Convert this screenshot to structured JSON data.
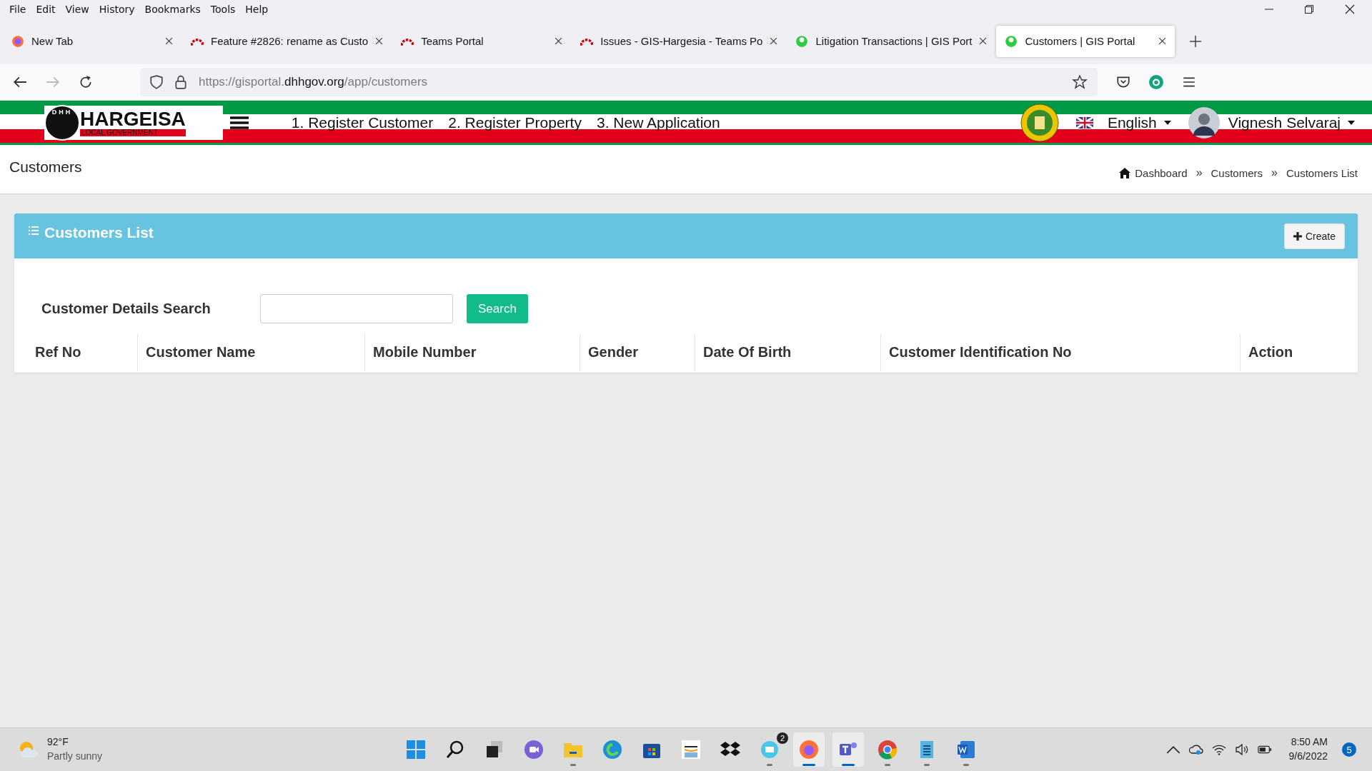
{
  "menu_bar": [
    "File",
    "Edit",
    "View",
    "History",
    "Bookmarks",
    "Tools",
    "Help"
  ],
  "tabs": [
    {
      "title": "New Tab",
      "kind": "firefox",
      "selected": false
    },
    {
      "title": "Feature #2826: rename as Custo",
      "kind": "redmine",
      "selected": false
    },
    {
      "title": "Teams Portal",
      "kind": "redmine",
      "selected": false
    },
    {
      "title": "Issues - GIS-Hargesia - Teams Po",
      "kind": "redmine",
      "selected": false
    },
    {
      "title": "Litigation Transactions | GIS Port",
      "kind": "gis",
      "selected": false
    },
    {
      "title": "Customers | GIS Portal",
      "kind": "gis",
      "selected": true
    }
  ],
  "address_bar": {
    "prefix": "https://gisportal.",
    "domain": "dhhgov.org",
    "path": "/app/customers"
  },
  "app_header": {
    "logo_initials": "DHH",
    "logo_title": "HARGEISA",
    "logo_subtitle": "LOCAL GOVERNMENT",
    "nav": [
      "1. Register Customer",
      "2. Register Property",
      "3. New Application"
    ],
    "language": "English",
    "user": "Vignesh Selvaraj"
  },
  "page": {
    "title": "Customers",
    "breadcrumb": [
      "Dashboard",
      "Customers",
      "Customers List"
    ],
    "separator": "»"
  },
  "panel": {
    "title": "Customers List",
    "create_button": "Create",
    "search_label": "Customer Details Search",
    "search_button": "Search",
    "columns": [
      "Ref No",
      "Customer Name",
      "Mobile Number",
      "Gender",
      "Date Of Birth",
      "Customer Identification No",
      "Action"
    ]
  },
  "taskbar": {
    "weather": {
      "temp": "92°F",
      "condition": "Partly sunny"
    },
    "apps": [
      {
        "kind": "start",
        "running": false,
        "active": false
      },
      {
        "kind": "search",
        "running": false,
        "active": false
      },
      {
        "kind": "taskview",
        "running": false,
        "active": false
      },
      {
        "kind": "chat",
        "running": false,
        "active": false
      },
      {
        "kind": "files",
        "running": true,
        "active": false
      },
      {
        "kind": "edge",
        "running": false,
        "active": false
      },
      {
        "kind": "store",
        "running": false,
        "active": false
      },
      {
        "kind": "amazon",
        "running": false,
        "active": false
      },
      {
        "kind": "dropbox",
        "running": false,
        "active": false
      },
      {
        "kind": "mail",
        "running": true,
        "active": false,
        "badge": "2"
      },
      {
        "kind": "firefox",
        "running": true,
        "active": true
      },
      {
        "kind": "teams",
        "running": true,
        "active": true
      },
      {
        "kind": "chrome",
        "running": true,
        "active": false
      },
      {
        "kind": "notepad",
        "running": true,
        "active": false
      },
      {
        "kind": "word",
        "running": true,
        "active": false
      }
    ],
    "time": "8:50 AM",
    "date": "9/6/2022",
    "notifications": "5"
  }
}
